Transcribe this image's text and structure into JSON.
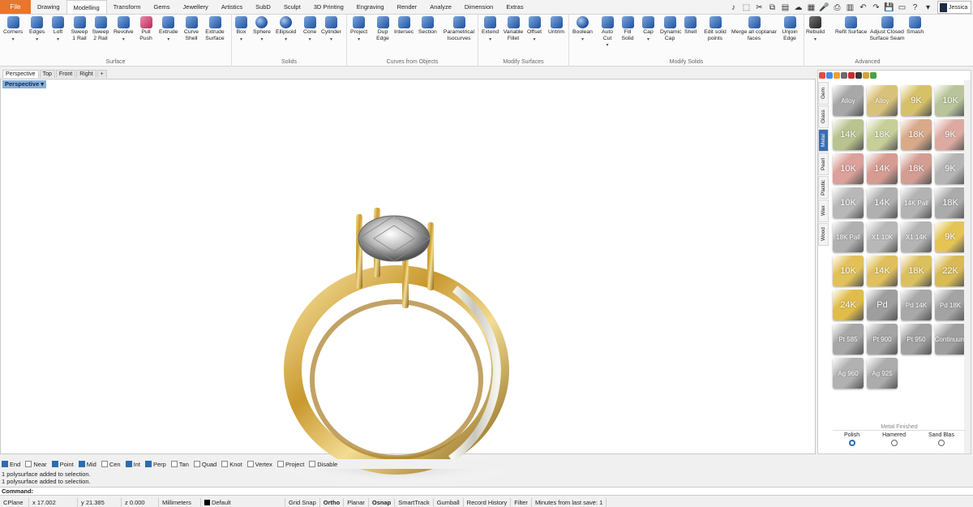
{
  "tabs": {
    "file": "File",
    "items": [
      "Drawing",
      "Modelling",
      "Transform",
      "Gems",
      "Jewellery",
      "Artistics",
      "SubD",
      "Sculpt",
      "3D Printing",
      "Engraving",
      "Render",
      "Analyze",
      "Dimension",
      "Extras"
    ],
    "active": "Modelling"
  },
  "user": {
    "name": "Jessica"
  },
  "ribbon": {
    "groups": {
      "surface": "Surface",
      "solids": "Solids",
      "curves": "Curves from Objects",
      "modify_surfaces": "Modify Surfaces",
      "modify_solids": "Modify Solids",
      "advanced": "Advanced"
    },
    "tools": {
      "corners": "Corners",
      "edges": "Edges",
      "loft": "Loft",
      "sweep1": "Sweep 1 Rail",
      "sweep2": "Sweep 2 Rail",
      "revolve": "Revolve",
      "pullpush": "Pull Push",
      "extrude": "Extrude",
      "curveshell": "Curve Shell",
      "extrudesurface": "Extrude Surface",
      "box": "Box",
      "sphere": "Sphere",
      "ellipsoid": "Ellipsoid",
      "cone": "Cone",
      "cylinder": "Cylinder",
      "project": "Project",
      "dupedge": "Dup Edge",
      "intersec": "Intersec",
      "section": "Section",
      "param": "Parametrical Isocurves",
      "extend": "Extend",
      "varfillet": "Variable Fillet",
      "offset": "Offset",
      "untrim": "Untrim",
      "boolean": "Boolean",
      "autocut": "Auto Cut",
      "fillsolid": "Fill Solid",
      "cap": "Cap",
      "dyncap": "Dynamic Cap",
      "shell": "Shell",
      "editpoints": "Edit solid points",
      "merge": "Merge all coplanar faces",
      "unjoin": "Unjoin Edge",
      "rebuild": "Rebuild",
      "refit": "Refit Surface",
      "adjust": "Adjust Closed Surface Seam",
      "smash": "Smash"
    }
  },
  "viewport": {
    "tabs": [
      "Perspective",
      "Top",
      "Front",
      "Right"
    ],
    "label": "Perspective"
  },
  "materials": {
    "side_tabs": [
      "Gem",
      "Glass",
      "Metal",
      "Pearl",
      "Plastic",
      "Wax",
      "Wood"
    ],
    "active_tab": "Metal",
    "swatches": [
      {
        "label": "Alloy",
        "color": "#a8a8a8"
      },
      {
        "label": "Alloy",
        "color": "#d8c27a"
      },
      {
        "label": "9K",
        "color": "#d7c168"
      },
      {
        "label": "10K",
        "color": "#b9c49a"
      },
      {
        "label": "14K",
        "color": "#b9c38f"
      },
      {
        "label": "18K",
        "color": "#c7cf98"
      },
      {
        "label": "18K",
        "color": "#d9a98a"
      },
      {
        "label": "9K",
        "color": "#dcaaa0"
      },
      {
        "label": "10K",
        "color": "#dba19a"
      },
      {
        "label": "14K",
        "color": "#d69c92"
      },
      {
        "label": "18K",
        "color": "#d39d92"
      },
      {
        "label": "9K",
        "color": "#b5b5b5"
      },
      {
        "label": "10K",
        "color": "#b8b8b8"
      },
      {
        "label": "14K",
        "color": "#b0b0b0"
      },
      {
        "label": "14K Pall",
        "color": "#b3b3b3"
      },
      {
        "label": "18K",
        "color": "#ababab"
      },
      {
        "label": "18K Pall",
        "color": "#b0b0b0"
      },
      {
        "label": "X1 10K",
        "color": "#b8b8b8"
      },
      {
        "label": "X1 14K",
        "color": "#b4b4b4"
      },
      {
        "label": "9K",
        "color": "#e4c455"
      },
      {
        "label": "10K",
        "color": "#e2c15a"
      },
      {
        "label": "14K",
        "color": "#dfc05c"
      },
      {
        "label": "18K",
        "color": "#dbc060"
      },
      {
        "label": "22K",
        "color": "#d8bb55"
      },
      {
        "label": "24K",
        "color": "#e0bd4a"
      },
      {
        "label": "Pd",
        "color": "#9e9e9e"
      },
      {
        "label": "Pd 14K",
        "color": "#a8a8a8"
      },
      {
        "label": "Pd 18K",
        "color": "#a3a3a3"
      },
      {
        "label": "Pt 585",
        "color": "#a7a7a7"
      },
      {
        "label": "Pt 900",
        "color": "#a5a5a5"
      },
      {
        "label": "Pt 950",
        "color": "#a1a1a1"
      },
      {
        "label": "Continuum",
        "color": "#9f9f9f"
      },
      {
        "label": "Ag 960",
        "color": "#b1b1b1"
      },
      {
        "label": "Ag 925",
        "color": "#acacac"
      }
    ],
    "finish_title": "Metal Finished",
    "finish_options": [
      "Polish",
      "Hamered",
      "Sand Blas"
    ],
    "finish_selected": 0
  },
  "osnap": [
    {
      "label": "End",
      "on": true
    },
    {
      "label": "Near",
      "on": false
    },
    {
      "label": "Point",
      "on": true
    },
    {
      "label": "Mid",
      "on": true
    },
    {
      "label": "Cen",
      "on": false
    },
    {
      "label": "Int",
      "on": true
    },
    {
      "label": "Perp",
      "on": true
    },
    {
      "label": "Tan",
      "on": false
    },
    {
      "label": "Quad",
      "on": false
    },
    {
      "label": "Knot",
      "on": false
    },
    {
      "label": "Vertex",
      "on": false
    },
    {
      "label": "Project",
      "on": false
    },
    {
      "label": "Disable",
      "on": false
    }
  ],
  "history": [
    "1 polysurface added to selection.",
    "1 polysurface added to selection."
  ],
  "command": {
    "label": "Command:"
  },
  "status": {
    "cplane": "CPlane",
    "x": "x 17.002",
    "y": "y 21.385",
    "z": "z 0.000",
    "units": "Millimeters",
    "layer": "Default",
    "toggles": [
      "Grid Snap",
      "Ortho",
      "Planar",
      "Osnap",
      "SmartTrack",
      "Gumball",
      "Record History",
      "Filter"
    ],
    "bold_toggles": [
      "Ortho",
      "Osnap"
    ],
    "save": "Minutes from last save: 1"
  }
}
